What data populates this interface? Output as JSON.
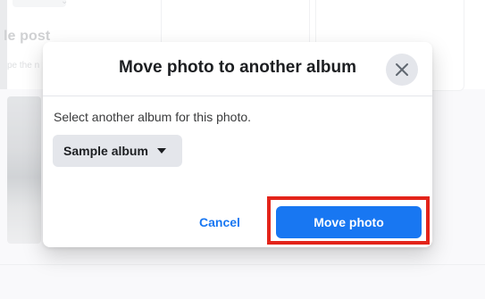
{
  "background": {
    "post_title": "le post",
    "post_subtitle": "pe the n",
    "chip_chevron": "⌄"
  },
  "dialog": {
    "title": "Move photo to another album",
    "close_icon": "close-icon",
    "prompt": "Select another album for this photo.",
    "album_select": {
      "selected": "Sample album",
      "icon": "caret-down-icon"
    },
    "cancel_label": "Cancel",
    "move_label": "Move photo",
    "highlight_color": "#e3241a",
    "accent_color": "#1877f2"
  }
}
